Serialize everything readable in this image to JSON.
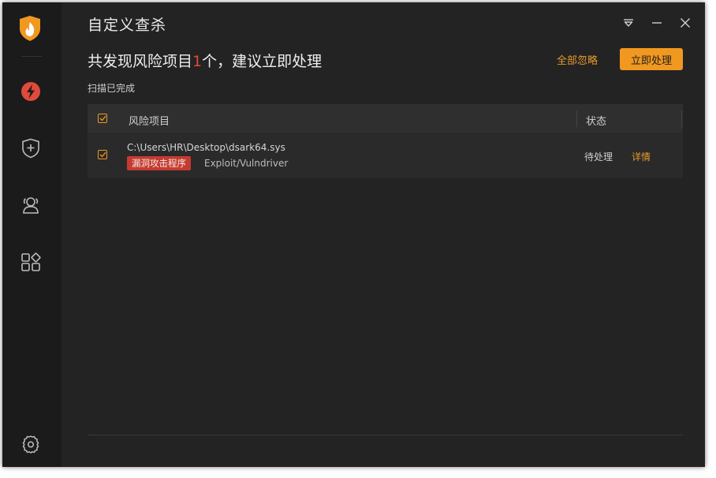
{
  "window": {
    "title": "自定义查杀"
  },
  "header": {
    "headline_prefix": "共发现风险项目",
    "headline_count": "1",
    "headline_suffix": "个，建议立即处理",
    "scan_status": "扫描已完成",
    "ignore_all_label": "全部忽略",
    "handle_now_label": "立即处理"
  },
  "table": {
    "columns": [
      "风险项目",
      "状态"
    ],
    "rows": [
      {
        "path": "C:\\Users\\HR\\Desktop\\dsark64.sys",
        "tag": "漏洞攻击程序",
        "virus_name": "Exploit/Vulndriver",
        "status": "待处理",
        "detail_label": "详情",
        "checked": true
      }
    ]
  },
  "sidebar": {
    "items": [
      "logo-icon",
      "quick-scan-icon",
      "shield-plus-icon",
      "users-icon",
      "apps-icon",
      "settings-icon"
    ]
  },
  "colors": {
    "accent": "#f0981f",
    "danger": "#c53b30",
    "background": "#232323",
    "sidebar": "#1b1b1b"
  }
}
